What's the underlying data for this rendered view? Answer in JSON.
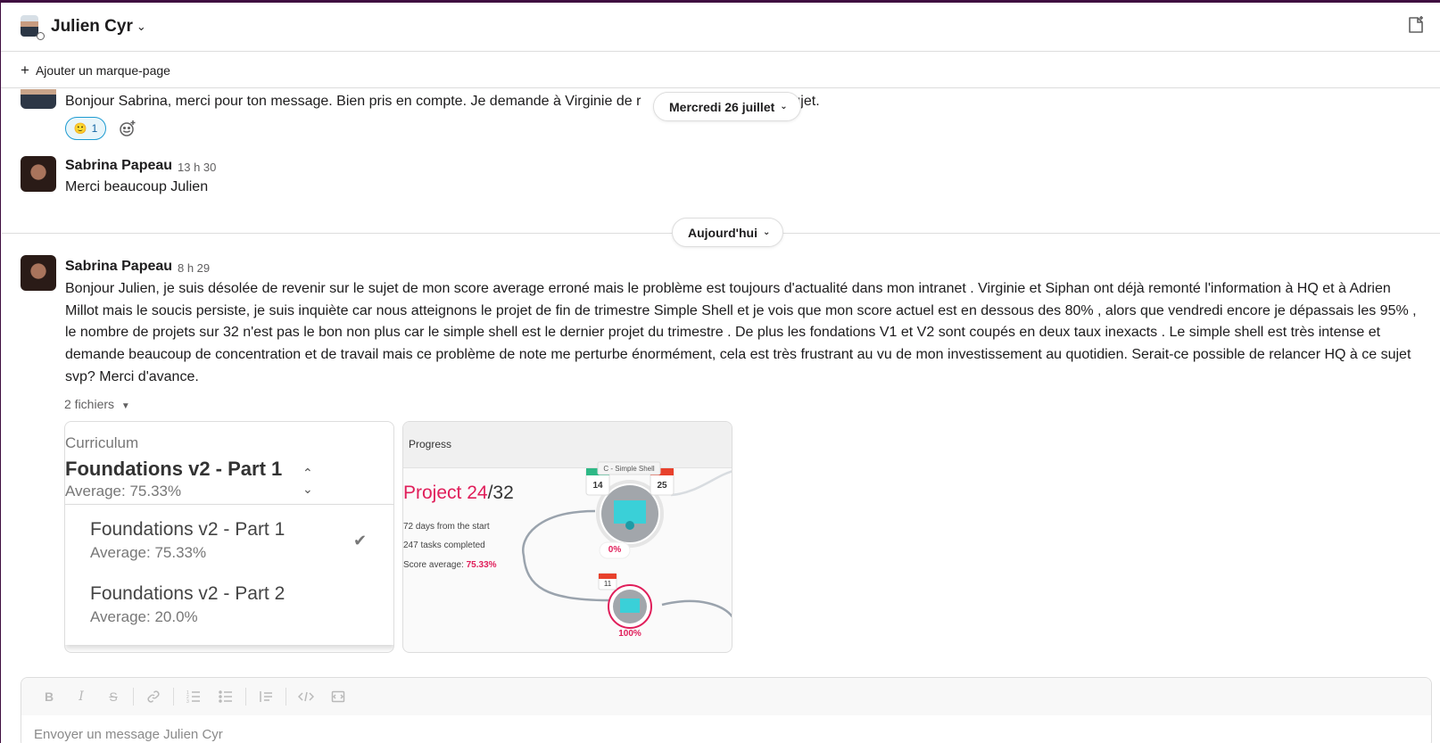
{
  "header": {
    "name": "Julien Cyr"
  },
  "bookmark": {
    "label": "Ajouter un marque-page"
  },
  "messages": [
    {
      "text": "Bonjour Sabrina, merci pour ton message. Bien pris en compte. Je demande à Virginie de r",
      "text_tail": "ujet.",
      "reaction_emoji": "🙂",
      "reaction_count": "1"
    },
    {
      "sender": "Sabrina Papeau",
      "time": "13 h 30",
      "text": "Merci beaucoup Julien"
    },
    {
      "sender": "Sabrina Papeau",
      "time": "8 h 29",
      "text": "Bonjour Julien, je suis désolée de revenir sur le sujet de mon score average erroné mais le problème est toujours d'actualité dans mon intranet . Virginie et Siphan ont déjà remonté l'information à HQ et à Adrien Millot mais  le soucis persiste,  je suis inquiète car nous atteignons le projet de fin de trimestre Simple Shell et je vois que mon score actuel est en dessous des 80% , alors que vendredi encore je dépassais les 95% ,  le nombre de projets sur 32 n'est pas le bon non plus car le simple shell est le dernier projet du trimestre . De plus les fondations V1 et V2 sont coupés en deux taux inexacts . Le simple shell est très intense et demande beaucoup de concentration et de travail  mais ce problème de note me perturbe énormément, cela est très frustrant au vu de mon investissement au quotidien. Serait-ce possible de relancer HQ à ce sujet svp? Merci d'avance.",
      "files_label": "2 fichiers"
    }
  ],
  "date_dividers": {
    "first": "Mercredi 26 juillet",
    "today": "Aujourd'hui"
  },
  "file1": {
    "curriculum": "Curriculum",
    "title": "Foundations v2 - Part 1",
    "average": "Average: 75.33%",
    "options": [
      {
        "title": "Foundations v2 - Part 1",
        "average": "Average: 75.33%"
      },
      {
        "title": "Foundations v2 - Part 2",
        "average": "Average: 20.0%"
      }
    ]
  },
  "file2": {
    "header": "Progress",
    "project_prefix": "Project ",
    "project_num": "24",
    "project_total": "/32",
    "days": "72 days from the start",
    "tasks": "247 tasks completed",
    "score_label": "Score average: ",
    "score_value": "75.33%",
    "node1_label": "C - Simple Shell",
    "node1_left": "14",
    "node1_right": "25",
    "node1_pct": "0%",
    "node2_tag": "11",
    "node2_pct": "100%"
  },
  "composer": {
    "placeholder": "Envoyer un message Julien Cyr"
  },
  "colors": {
    "accent": "#1264a3",
    "brand": "#3f0e40",
    "red": "#e01e5a"
  }
}
